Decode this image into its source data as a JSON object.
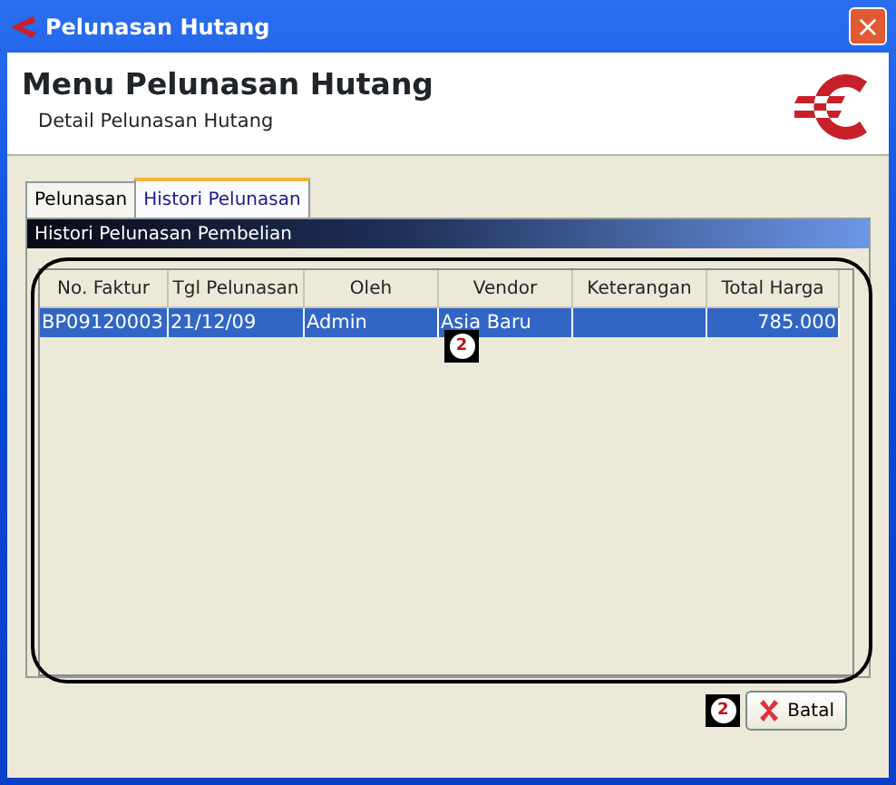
{
  "window": {
    "title": "Pelunasan Hutang",
    "close": "×"
  },
  "header": {
    "title": "Menu Pelunasan Hutang",
    "subtitle": "Detail Pelunasan Hutang"
  },
  "tabs": [
    {
      "label": "Pelunasan",
      "selected": false
    },
    {
      "label": "Histori Pelunasan",
      "selected": true
    }
  ],
  "panel": {
    "title": "Histori Pelunasan Pembelian"
  },
  "table": {
    "columns": [
      "No. Faktur",
      "Tgl Pelunasan",
      "Oleh",
      "Vendor",
      "Keterangan",
      "Total Harga"
    ],
    "rows": [
      {
        "cells": [
          "BP09120003",
          "21/12/09",
          "Admin",
          "Asia Baru",
          "",
          "785.000"
        ],
        "selected": true
      }
    ]
  },
  "callouts": [
    "2",
    "2"
  ],
  "buttons": [
    {
      "label": "Batal"
    }
  ]
}
